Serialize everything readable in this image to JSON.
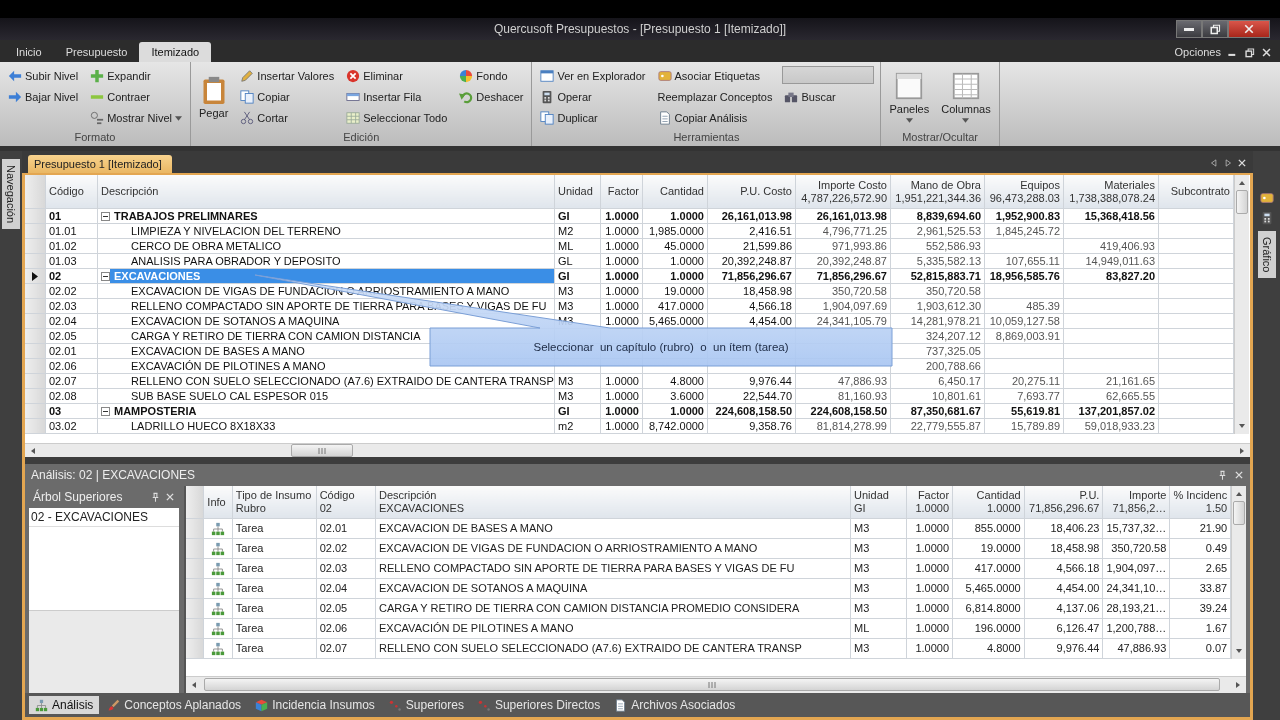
{
  "window": {
    "title": "Quercusoft Presupuestos - [Presupuesto 1 [Itemizado]]"
  },
  "ribbon_tabs": [
    {
      "label": "Inicio",
      "selected": false
    },
    {
      "label": "Presupuesto",
      "selected": false
    },
    {
      "label": "Itemizado",
      "selected": true
    }
  ],
  "options_menu": {
    "label": "Opciones"
  },
  "ribbon": {
    "groups": [
      {
        "label": "Formato",
        "columns": [
          [
            {
              "kind": "small",
              "label": "Subir Nivel",
              "dropdown": false
            },
            {
              "kind": "small",
              "label": "Bajar Nivel",
              "dropdown": false
            }
          ],
          [
            {
              "kind": "small",
              "label": "Expandir",
              "dropdown": false
            },
            {
              "kind": "small",
              "label": "Contraer",
              "dropdown": false
            },
            {
              "kind": "small",
              "label": "Mostrar Nivel",
              "dropdown": true
            }
          ]
        ]
      },
      {
        "label": "Edición",
        "columns": [
          [
            {
              "kind": "large",
              "label": "Pegar",
              "dropdown": false
            }
          ],
          [
            {
              "kind": "small",
              "label": "Insertar Valores",
              "dropdown": false
            },
            {
              "kind": "small",
              "label": "Copiar",
              "dropdown": false
            },
            {
              "kind": "small",
              "label": "Cortar",
              "dropdown": false
            }
          ],
          [
            {
              "kind": "small",
              "label": "Eliminar",
              "dropdown": false
            },
            {
              "kind": "small",
              "label": "Insertar Fila",
              "dropdown": false
            },
            {
              "kind": "small",
              "label": "Seleccionar Todo",
              "dropdown": false
            }
          ],
          [
            {
              "kind": "small",
              "label": "Fondo",
              "dropdown": false
            },
            {
              "kind": "small",
              "label": "Deshacer",
              "dropdown": false
            }
          ]
        ]
      },
      {
        "label": "Herramientas",
        "columns": [
          [
            {
              "kind": "small",
              "label": "Ver en Explorador",
              "dropdown": false
            },
            {
              "kind": "small",
              "label": "Operar",
              "dropdown": false
            },
            {
              "kind": "small",
              "label": "Duplicar",
              "dropdown": false
            }
          ],
          [
            {
              "kind": "small",
              "label": "Asociar Etiquetas",
              "dropdown": false
            },
            {
              "kind": "small",
              "label": "Reemplazar Conceptos",
              "dropdown": false
            },
            {
              "kind": "small",
              "label": "Copiar Análisis",
              "dropdown": false
            }
          ],
          [
            {
              "kind": "field"
            },
            {
              "kind": "small",
              "label": "Buscar",
              "dropdown": false
            }
          ]
        ]
      },
      {
        "label": "Mostrar/Ocultar",
        "columns": [
          [
            {
              "kind": "large",
              "label": "Paneles",
              "dropdown": true
            }
          ],
          [
            {
              "kind": "large",
              "label": "Columnas",
              "dropdown": true
            }
          ]
        ]
      }
    ]
  },
  "left_dock": {
    "label": "Navegación"
  },
  "right_dock": {
    "label": "Gráfico"
  },
  "document_tab": {
    "label": "Presupuesto 1 [Itemizado]"
  },
  "budget_table": {
    "columns": [
      {
        "label": "Código"
      },
      {
        "label": "Descripción"
      },
      {
        "label": "Unidad"
      },
      {
        "label": "Factor"
      },
      {
        "label": "Cantidad"
      },
      {
        "label": "P.U. Costo"
      },
      {
        "label": "Importe Costo",
        "total": "4,787,226,572.90"
      },
      {
        "label": "Mano de Obra",
        "total": "1,951,221,344.36"
      },
      {
        "label": "Equipos",
        "total": "96,473,288.03"
      },
      {
        "label": "Materiales",
        "total": "1,738,388,078.24"
      },
      {
        "label": "Subcontrato"
      }
    ],
    "rows": [
      {
        "kind": "chapter",
        "expanded": true,
        "selected": false,
        "cells": [
          "01",
          "TRABAJOS PRELIMNARES",
          "GI",
          "1.0000",
          "1.0000",
          "26,161,013.98",
          "26,161,013.98",
          "8,839,694.60",
          "1,952,900.83",
          "15,368,418.56"
        ]
      },
      {
        "kind": "item",
        "selected": false,
        "cells": [
          "01.01",
          "LIMPIEZA Y NIVELACION DEL TERRENO",
          "M2",
          "1.0000",
          "1,985.0000",
          "2,416.51",
          "4,796,771.25",
          "2,961,525.53",
          "1,845,245.72",
          null
        ]
      },
      {
        "kind": "item",
        "selected": false,
        "cells": [
          "01.02",
          "CERCO DE OBRA METALICO",
          "ML",
          "1.0000",
          "45.0000",
          "21,599.86",
          "971,993.86",
          "552,586.93",
          null,
          "419,406.93"
        ]
      },
      {
        "kind": "item",
        "selected": false,
        "cells": [
          "01.03",
          "ANALISIS PARA OBRADOR Y DEPOSITO",
          "GL",
          "1.0000",
          "1.0000",
          "20,392,248.87",
          "20,392,248.87",
          "5,335,582.13",
          "107,655.11",
          "14,949,011.63"
        ]
      },
      {
        "kind": "chapter",
        "expanded": true,
        "selected": true,
        "cells": [
          "02",
          "EXCAVACIONES",
          "GI",
          "1.0000",
          "1.0000",
          "71,856,296.67",
          "71,856,296.67",
          "52,815,883.71",
          "18,956,585.76",
          "83,827.20"
        ]
      },
      {
        "kind": "item",
        "selected": false,
        "cells": [
          "02.02",
          "EXCAVACION DE VIGAS DE FUNDACION O ARRIOSTRAMIENTO A MANO",
          "M3",
          "1.0000",
          "19.0000",
          "18,458.98",
          "350,720.58",
          "350,720.58",
          null,
          null
        ]
      },
      {
        "kind": "item",
        "selected": false,
        "cells": [
          "02.03",
          "RELLENO COMPACTADO SIN APORTE DE TIERRA PARA BASES Y VIGAS DE FU",
          "M3",
          "1.0000",
          "417.0000",
          "4,566.18",
          "1,904,097.69",
          "1,903,612.30",
          "485.39",
          null
        ]
      },
      {
        "kind": "item",
        "selected": false,
        "cells": [
          "02.04",
          "EXCAVACION DE SOTANOS A MAQUINA",
          "M3",
          "1.0000",
          "5,465.0000",
          "4,454.00",
          "24,341,105.79",
          "14,281,978.21",
          "10,059,127.58",
          null
        ]
      },
      {
        "kind": "item",
        "selected": false,
        "cells": [
          "02.05",
          "CARGA Y RETIRO DE TIERRA CON CAMION DISTANCIA",
          null,
          null,
          null,
          null,
          null,
          "324,207.12",
          "8,869,003.91",
          null
        ]
      },
      {
        "kind": "item",
        "selected": false,
        "cells": [
          "02.01",
          "EXCAVACION DE BASES A MANO",
          null,
          null,
          null,
          null,
          null,
          "737,325.05",
          null,
          null
        ]
      },
      {
        "kind": "item",
        "selected": false,
        "cells": [
          "02.06",
          "EXCAVACIÓN DE PILOTINES A MANO",
          null,
          null,
          null,
          null,
          null,
          "200,788.66",
          null,
          null
        ]
      },
      {
        "kind": "item",
        "selected": false,
        "cells": [
          "02.07",
          "RELLENO CON SUELO SELECCIONADO (A7.6) EXTRAIDO DE CANTERA TRANSP",
          "M3",
          "1.0000",
          "4.8000",
          "9,976.44",
          "47,886.93",
          "6,450.17",
          "20,275.11",
          "21,161.65"
        ]
      },
      {
        "kind": "item",
        "selected": false,
        "cells": [
          "02.08",
          "SUB BASE SUELO CAL ESPESOR 015",
          "M3",
          "1.0000",
          "3.6000",
          "22,544.70",
          "81,160.93",
          "10,801.61",
          "7,693.77",
          "62,665.55"
        ]
      },
      {
        "kind": "chapter",
        "expanded": true,
        "selected": false,
        "cells": [
          "03",
          "MAMPOSTERIA",
          "GI",
          "1.0000",
          "1.0000",
          "224,608,158.50",
          "224,608,158.50",
          "87,350,681.67",
          "55,619.81",
          "137,201,857.02"
        ]
      },
      {
        "kind": "item",
        "selected": false,
        "cells": [
          "03.02",
          "LADRILLO HUECO 8X18X33",
          "m2",
          "1.0000",
          "8,742.0000",
          "9,358.76",
          "81,814,278.99",
          "22,779,555.87",
          "15,789.89",
          "59,018,933.23"
        ]
      }
    ]
  },
  "callout": {
    "text": "Seleccionar  un capítulo (rubro)  o  un ítem (tarea)"
  },
  "analysis_panel": {
    "title": "Análisis: 02 | EXCAVACIONES",
    "tree_panel": {
      "title": "Árbol Superiores",
      "items": [
        "02 - EXCAVACIONES"
      ]
    },
    "grid": {
      "columns": [
        {
          "label": "Info"
        },
        {
          "label": "Tipo de Insumo",
          "sub": "Rubro"
        },
        {
          "label": "Código",
          "sub": "02"
        },
        {
          "label": "Descripción",
          "sub": "EXCAVACIONES"
        },
        {
          "label": "Unidad",
          "sub": "GI"
        },
        {
          "label": "Factor",
          "sub": "1.0000"
        },
        {
          "label": "Cantidad",
          "sub": "1.0000"
        },
        {
          "label": "P.U.",
          "sub": "71,856,296.67"
        },
        {
          "label": "Importe",
          "sub": "71,856,2…"
        },
        {
          "label": "% Incidenc",
          "sub": "1.50"
        }
      ],
      "rows": [
        [
          null,
          "Tarea",
          "02.01",
          "EXCAVACION DE BASES A MANO",
          "M3",
          "1.0000",
          "855.0000",
          "18,406.23",
          "15,737,32…",
          "21.90"
        ],
        [
          null,
          "Tarea",
          "02.02",
          "EXCAVACION DE VIGAS DE FUNDACION O ARRIOSTRAMIENTO A MANO",
          "M3",
          "1.0000",
          "19.0000",
          "18,458.98",
          "350,720.58",
          "0.49"
        ],
        [
          null,
          "Tarea",
          "02.03",
          "RELLENO COMPACTADO SIN APORTE DE TIERRA PARA BASES Y VIGAS DE FU",
          "M3",
          "1.0000",
          "417.0000",
          "4,566.18",
          "1,904,097…",
          "2.65"
        ],
        [
          null,
          "Tarea",
          "02.04",
          "EXCAVACION DE SOTANOS A MAQUINA",
          "M3",
          "1.0000",
          "5,465.0000",
          "4,454.00",
          "24,341,10…",
          "33.87"
        ],
        [
          null,
          "Tarea",
          "02.05",
          "CARGA Y RETIRO DE TIERRA CON CAMION DISTANCIA PROMEDIO CONSIDERA",
          "M3",
          "1.0000",
          "6,814.8000",
          "4,137.06",
          "28,193,21…",
          "39.24"
        ],
        [
          null,
          "Tarea",
          "02.06",
          "EXCAVACIÓN DE PILOTINES A MANO",
          "ML",
          "1.0000",
          "196.0000",
          "6,126.47",
          "1,200,788…",
          "1.67"
        ],
        [
          null,
          "Tarea",
          "02.07",
          "RELLENO CON SUELO SELECCIONADO (A7.6) EXTRAIDO DE CANTERA TRANSP",
          "M3",
          "1.0000",
          "4.8000",
          "9,976.44",
          "47,886.93",
          "0.07"
        ]
      ]
    }
  },
  "bottom_tabs": [
    {
      "label": "Análisis",
      "selected": true
    },
    {
      "label": "Conceptos Aplanados",
      "selected": false
    },
    {
      "label": "Incidencia Insumos",
      "selected": false
    },
    {
      "label": "Superiores",
      "selected": false
    },
    {
      "label": "Superiores Directos",
      "selected": false
    },
    {
      "label": "Archivos Asociados",
      "selected": false
    }
  ]
}
